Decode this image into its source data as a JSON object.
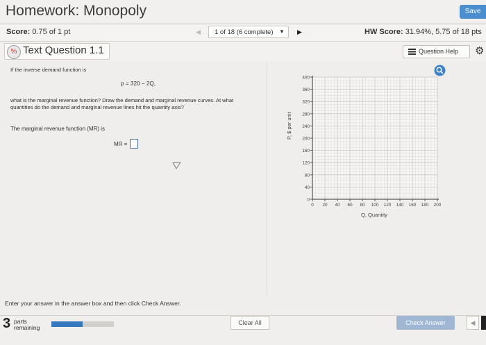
{
  "app": {
    "title": "Homework: Monopoly",
    "save_label": "Save"
  },
  "score_bar": {
    "score_label": "Score:",
    "score_value": "0.75 of 1 pt",
    "question_select": "1 of 18 (6 complete)",
    "hw_score_label": "HW Score:",
    "hw_score_value": "31.94%, 5.75 of 18 pts"
  },
  "question": {
    "title": "Text Question 1.1",
    "help_label": "Question Help",
    "intro": "If the inverse demand function is",
    "equation": "p = 320 − 2Q,",
    "prompt": "what is the marginal revenue function? Draw the demand and marginal revenue curves. At what quantities do the demand and marginal revenue lines hit the quantity axis?",
    "mr_prompt": "The marginal revenue function (MR) is",
    "mr_label": "MR =",
    "mr_value": ""
  },
  "chart_data": {
    "type": "scatter",
    "title": "",
    "xlabel": "Q, Quantity",
    "ylabel": "P, $ per unit",
    "xlim": [
      0,
      200
    ],
    "ylim": [
      0,
      400
    ],
    "xticks": [
      0,
      20,
      40,
      60,
      80,
      100,
      120,
      140,
      160,
      180,
      200
    ],
    "yticks": [
      0,
      40,
      80,
      120,
      160,
      200,
      240,
      280,
      320,
      360,
      400
    ],
    "grid": true,
    "series": []
  },
  "instructions": "Enter your answer in the answer box and then click Check Answer.",
  "footer": {
    "parts_count": "3",
    "parts_label_1": "parts",
    "parts_label_2": "remaining",
    "progress": 0.5,
    "clear_label": "Clear All",
    "check_label": "Check Answer"
  }
}
